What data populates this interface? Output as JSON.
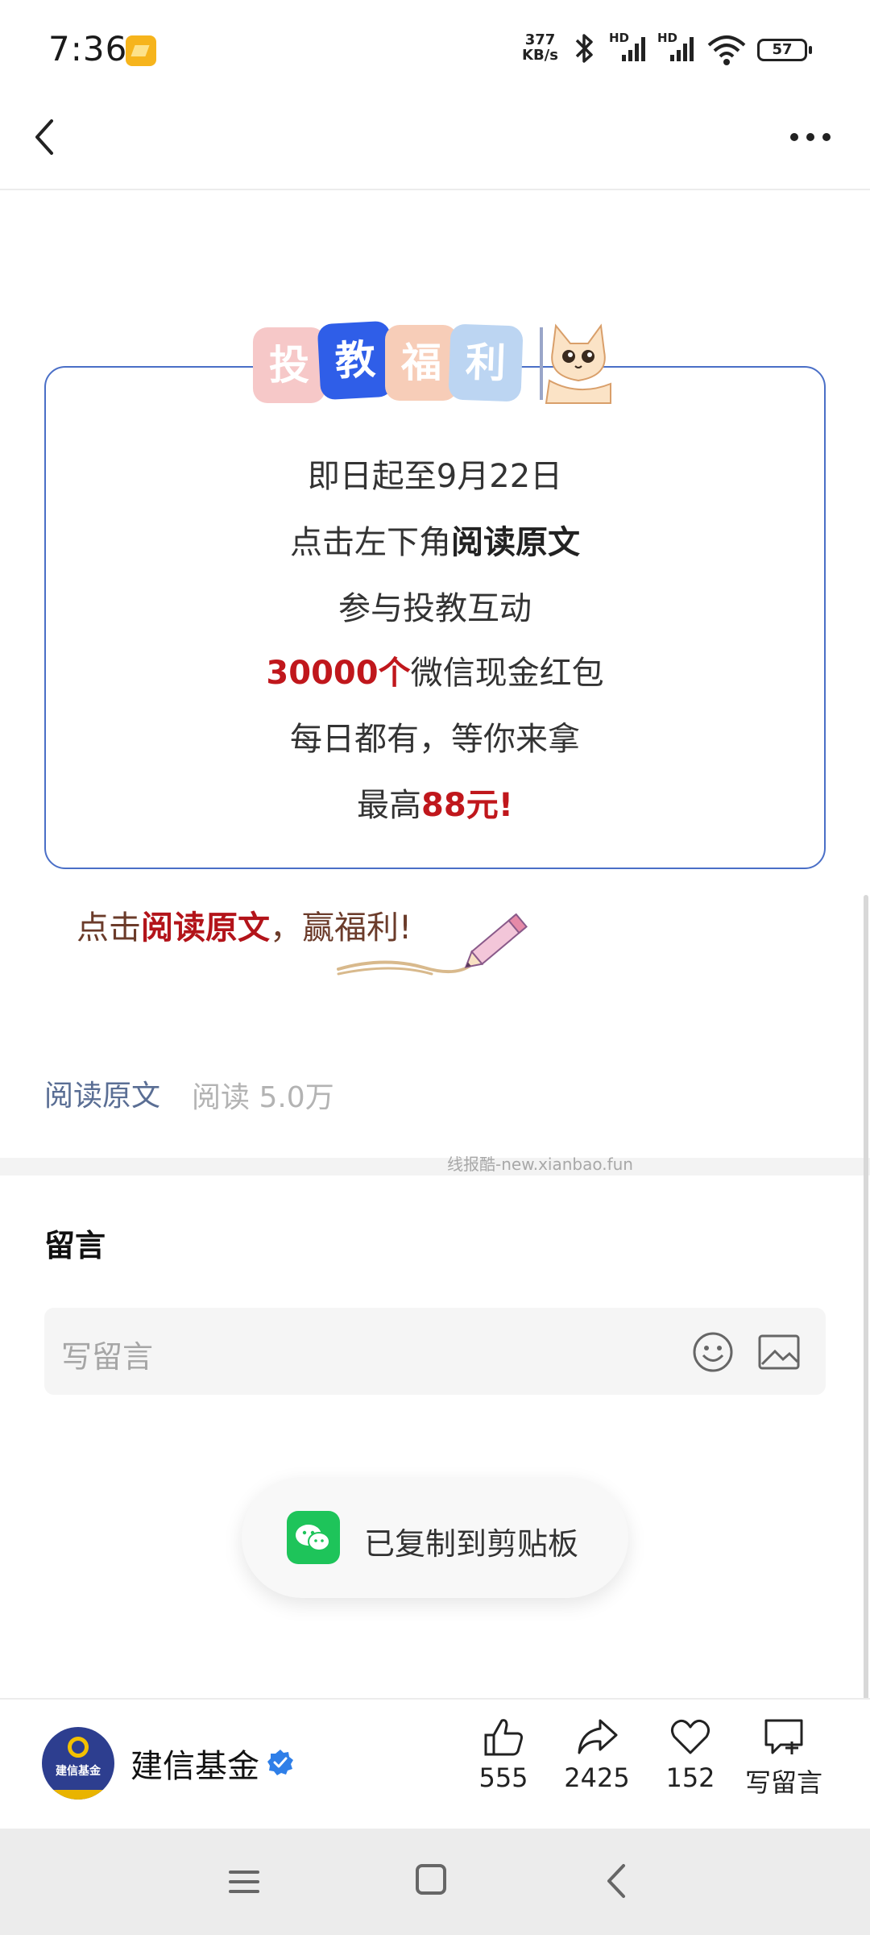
{
  "status_bar": {
    "time": "7:36",
    "net_speed_value": "377",
    "net_speed_unit": "KB/s",
    "signal1_label": "HD",
    "signal2_label": "HD",
    "battery": "57"
  },
  "promo": {
    "title_tiles": [
      "投",
      "教",
      "福",
      "利"
    ],
    "line1": "即日起至9月22日",
    "line2_prefix": "点击左下角",
    "line2_bold": "阅读原文",
    "line3": "参与投教互动",
    "line4_highlight": "30000个",
    "line4_rest": "微信现金红包",
    "line5": "每日都有，等你来拿",
    "line6_prefix": "最高",
    "line6_highlight": "88元!",
    "cta_prefix": "点击",
    "cta_highlight": "阅读原文",
    "cta_suffix": "，赢福利!"
  },
  "article_footer": {
    "read_original": "阅读原文",
    "read_count": "阅读 5.0万"
  },
  "watermark": "线报酷-new.xianbao.fun",
  "comments": {
    "title": "留言",
    "placeholder": "写留言"
  },
  "toast": {
    "text": "已复制到剪贴板"
  },
  "bottom_bar": {
    "account_name": "建信基金",
    "avatar_text": "建信基金",
    "likes": "555",
    "shares": "2425",
    "favorites": "152",
    "write_comment": "写留言"
  },
  "colors": {
    "accent_red": "#c0171c",
    "link_blue": "#5a6e94",
    "promo_border": "#4a6fc7",
    "wechat_green": "#1ec45a"
  }
}
